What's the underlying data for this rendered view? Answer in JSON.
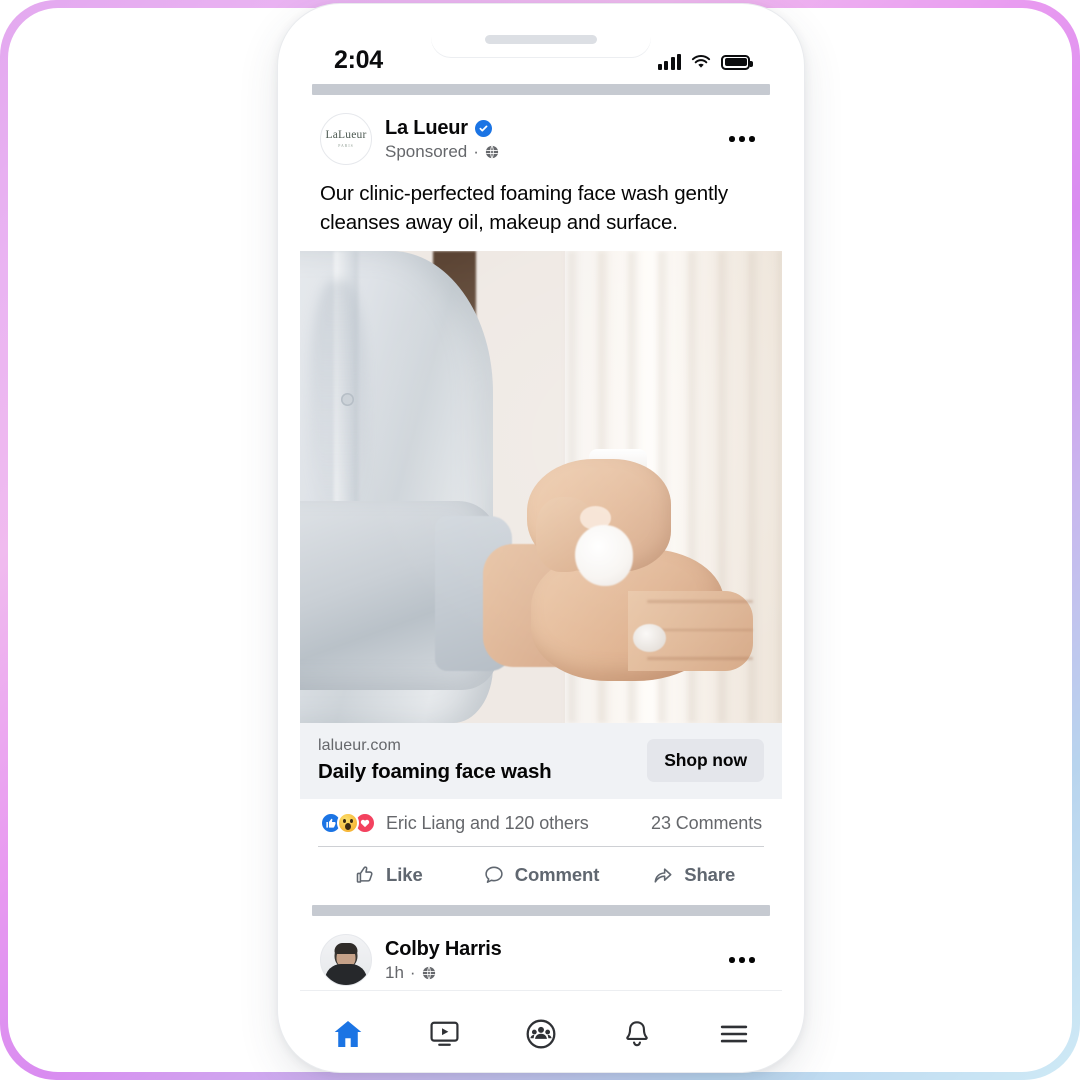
{
  "status_bar": {
    "time": "2:04",
    "signal_icon": "cellular-signal-icon",
    "wifi_icon": "wifi-icon",
    "battery_icon": "battery-full-icon"
  },
  "sponsored_post": {
    "author": "La Lueur",
    "verified_icon": "verified-badge-icon",
    "subtitle": "Sponsored",
    "separator": "·",
    "audience_icon": "globe-icon",
    "menu_icon": "more-options-icon",
    "avatar": {
      "logo_text": "LaLueur",
      "logo_subtext": "PARIS"
    },
    "body_text": "Our clinic-perfected foaming face wash gently cleanses away oil, makeup and surface.",
    "image_alt": "Hands dispensing white foam from a pump bottle",
    "link_card": {
      "domain": "lalueur.com",
      "title": "Daily foaming face wash",
      "cta_label": "Shop now"
    },
    "reactions": {
      "icons": [
        "like-reaction-icon",
        "wow-reaction-icon",
        "love-reaction-icon"
      ],
      "summary": "Eric Liang and 120 others",
      "comments": "23 Comments"
    },
    "actions": [
      {
        "label": "Like",
        "icon": "thumbs-up-icon"
      },
      {
        "label": "Comment",
        "icon": "comment-bubble-icon"
      },
      {
        "label": "Share",
        "icon": "share-arrow-icon"
      }
    ]
  },
  "next_post": {
    "author": "Colby Harris",
    "timestamp": "1h",
    "separator": "·",
    "audience_icon": "globe-icon",
    "menu_icon": "more-options-icon"
  },
  "bottom_nav": [
    {
      "name": "home",
      "icon": "home-icon",
      "active": true
    },
    {
      "name": "watch",
      "icon": "video-icon",
      "active": false
    },
    {
      "name": "groups",
      "icon": "groups-icon",
      "active": false
    },
    {
      "name": "notifications",
      "icon": "bell-icon",
      "active": false
    },
    {
      "name": "menu",
      "icon": "hamburger-menu-icon",
      "active": false
    }
  ],
  "colors": {
    "accent_blue": "#1b74e4",
    "love_red": "#f3425f",
    "wow_yellow": "#f5a623",
    "text_primary": "#050505",
    "text_secondary": "#65676b",
    "chip_bg": "#e4e6eb",
    "card_bg": "#f0f2f5",
    "frame_gradient_start": "#e3a8ef",
    "frame_gradient_end": "#cfeaf6"
  }
}
